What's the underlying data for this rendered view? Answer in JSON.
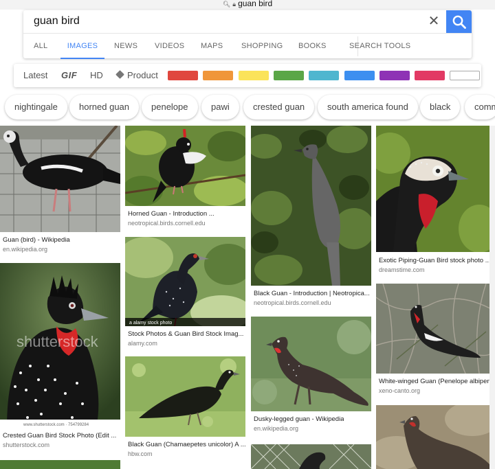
{
  "browser": {
    "url": "guan bird"
  },
  "search": {
    "query": "guan bird"
  },
  "tabs": [
    "ALL",
    "IMAGES",
    "NEWS",
    "VIDEOS",
    "MAPS",
    "SHOPPING",
    "BOOKS",
    "SEARCH TOOLS"
  ],
  "active_tab": "IMAGES",
  "filters": {
    "latest": "Latest",
    "gif": "GIF",
    "hd": "HD",
    "product": "Product"
  },
  "color_swatches": [
    "#e0473e",
    "#f0963a",
    "#fbe35a",
    "#5aa647",
    "#4fb6cf",
    "#3d8ff0",
    "#8e33b5",
    "#e23a64",
    "#ffffff"
  ],
  "chips": [
    "nightingale",
    "horned guan",
    "penelope",
    "pawi",
    "crested guan",
    "south america found",
    "black",
    "comm"
  ],
  "results": [
    {
      "caption": "Guan (bird) - Wikipedia",
      "source": "en.wikipedia.org"
    },
    {
      "caption": "Crested Guan Bird Stock Photo (Edit ...",
      "source": "shutterstock.com",
      "watermark": "shutterstock",
      "watermark_small": "www.shutterstock.com · 754799284"
    },
    {
      "caption": "Horned Guan - Introduction ...",
      "source": "neotropical.birds.cornell.edu"
    },
    {
      "caption": "Stock Photos & Guan Bird Stock Imag...",
      "source": "alamy.com",
      "watermark": "a  alamy stock photo"
    },
    {
      "caption": "Black Guan (Chamaepetes unicolor) A ...",
      "source": "hbw.com"
    },
    {
      "caption": "Black Guan - Introduction | Neotropica...",
      "source": "neotropical.birds.cornell.edu"
    },
    {
      "caption": "Dusky-legged guan - Wikipedia",
      "source": "en.wikipedia.org"
    },
    {
      "caption": "Exotic Piping-Guan Bird stock photo ...",
      "source": "dreamstime.com"
    },
    {
      "caption": "White-winged Guan (Penelope albipen...",
      "source": "xeno-canto.org"
    }
  ]
}
